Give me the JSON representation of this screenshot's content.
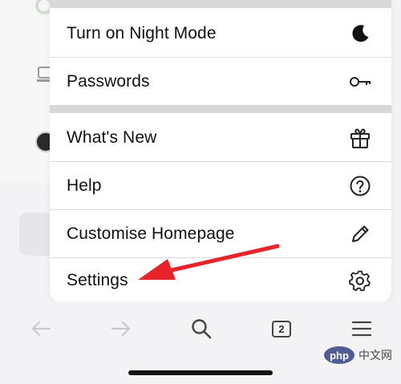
{
  "menu": {
    "items": [
      {
        "label": "Turn on Night Mode",
        "icon": "moon-icon"
      },
      {
        "label": "Passwords",
        "icon": "key-icon"
      },
      {
        "label": "What's New",
        "icon": "gift-icon"
      },
      {
        "label": "Help",
        "icon": "question-circle-icon"
      },
      {
        "label": "Customise Homepage",
        "icon": "pencil-icon"
      },
      {
        "label": "Settings",
        "icon": "gear-icon"
      }
    ]
  },
  "toolbar": {
    "tab_count": "2",
    "buttons": [
      "back-arrow-icon",
      "forward-arrow-icon",
      "search-icon",
      "tabs-icon",
      "menu-icon"
    ]
  },
  "watermark": {
    "badge": "php",
    "text": "中文网"
  },
  "colors": {
    "annotation_arrow": "#e8242b",
    "menu_background": "#ffffff",
    "section_separator": "#d8d8da"
  }
}
